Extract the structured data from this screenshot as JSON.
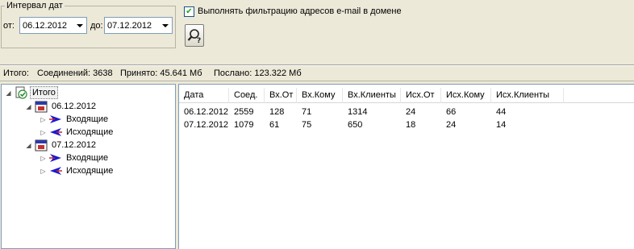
{
  "filter": {
    "group_title": "Интервал дат",
    "from_label": "от:",
    "from_value": "06.12.2012",
    "to_label": "до:",
    "to_value": "07.12.2012",
    "domain_filter_checked": true,
    "domain_filter_label": "Выполнять фильтрацию адресов e-mail в домене"
  },
  "summary": {
    "total": "Итого:",
    "connections": "Соединений: 3638",
    "received": "Принято: 45.641 Мб",
    "sent": "Послано: 123.322 Мб"
  },
  "tree": {
    "root": "Итого",
    "dates": [
      {
        "label": "06.12.2012",
        "children": [
          "Входящие",
          "Исходящие"
        ]
      },
      {
        "label": "07.12.2012",
        "children": [
          "Входящие",
          "Исходящие"
        ]
      }
    ]
  },
  "grid": {
    "columns": [
      "Дата",
      "Соед.",
      "Вх.От",
      "Вх.Кому",
      "Вх.Клиенты",
      "Исх.От",
      "Исх.Кому",
      "Исх.Клиенты"
    ],
    "rows": [
      [
        "06.12.2012",
        "2559",
        "128",
        "71",
        "1314",
        "24",
        "66",
        "44"
      ],
      [
        "07.12.2012",
        "1079",
        "61",
        "75",
        "650",
        "18",
        "24",
        "14"
      ]
    ]
  },
  "icons": {
    "search": "search-help-icon",
    "root": "check-doc-icon",
    "date": "calendar-icon",
    "incoming": "incoming-arrow-icon",
    "outgoing": "outgoing-arrow-icon"
  },
  "colors": {
    "window_bg": "#ece9d8",
    "incoming_arrow": "#1a1ad0",
    "arrow_accent": "#d02020"
  }
}
